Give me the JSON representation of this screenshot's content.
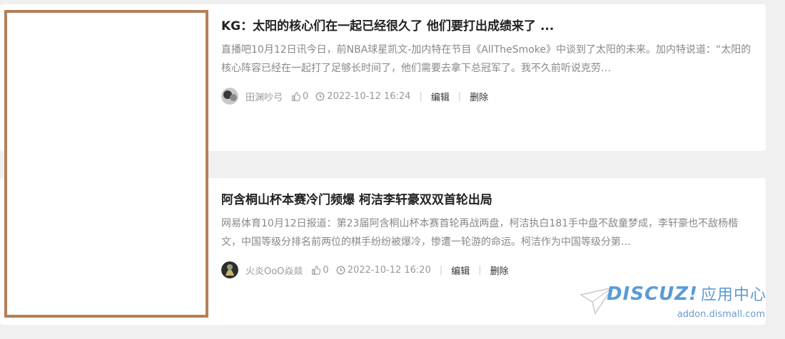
{
  "posts": [
    {
      "title": "KG：太阳的核心们在一起已经很久了 他们要打出成绩来了 ...",
      "summary": "直播吧10月12日讯今日，前NBA球星凯文-加内特在节目《AllTheSmoke》中谈到了太阳的未来。加内特说道：“太阳的核心阵容已经在一起打了足够长时间了，他们需要去拿下总冠军了。我不久前听说克劳…",
      "author": "田渊吵弓",
      "likes": "0",
      "time": "2022-10-12 16:24",
      "edit_label": "编辑",
      "delete_label": "删除"
    },
    {
      "title": "阿含桐山杯本赛冷门频爆 柯洁李轩豪双双首轮出局",
      "summary": "网易体育10月12日报道：第23届阿含桐山杯本赛首轮再战两盘，柯洁执白181手中盘不敌童梦成，李轩豪也不敌杨楷文，中国等级分排名前两位的棋手纷纷被爆冷，惨遭一轮游的命运。柯洁作为中国等级分第…",
      "author": "火炎OoO焱燚",
      "likes": "0",
      "time": "2022-10-12 16:20",
      "edit_label": "编辑",
      "delete_label": "删除"
    }
  ],
  "watermark": {
    "logo": "DISCUZ!",
    "logo_cn": "应用中心",
    "url": "addon.dismall.com"
  },
  "colors": {
    "thumb_border": "#b47f58",
    "watermark": "#5b9bd5"
  }
}
